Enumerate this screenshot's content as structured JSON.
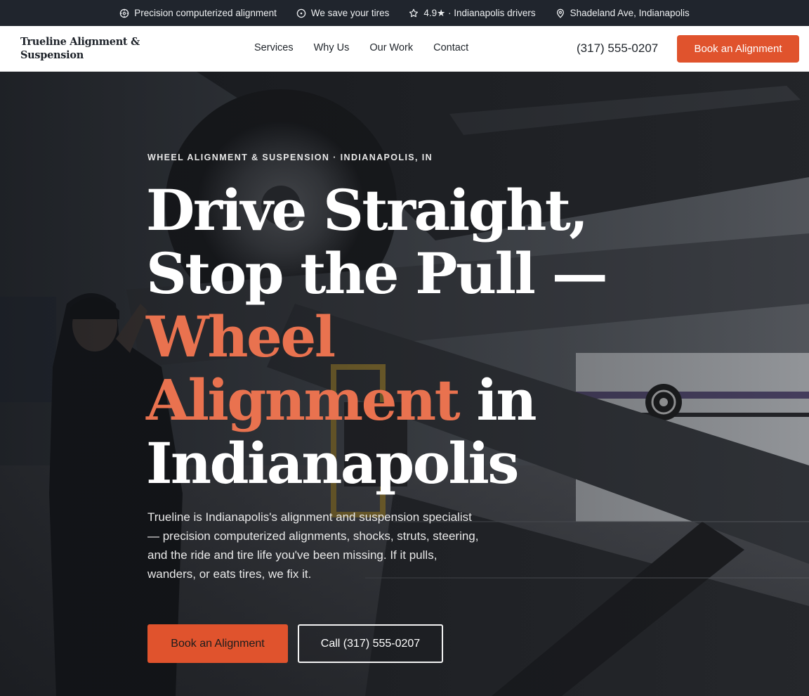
{
  "topbar": {
    "items": [
      {
        "icon": "crosshair-icon",
        "text": "Precision computerized alignment"
      },
      {
        "icon": "tire-icon",
        "text": "We save your tires"
      },
      {
        "icon": "star-icon",
        "text": "4.9★ · Indianapolis drivers"
      },
      {
        "icon": "map-pin-icon",
        "text": "Shadeland Ave, Indianapolis"
      }
    ]
  },
  "header": {
    "logo_line1": "Trueline Alignment &",
    "logo_line2": "Suspension",
    "nav": [
      "Services",
      "Why Us",
      "Our Work",
      "Contact"
    ],
    "phone": "(317) 555-0207",
    "cta": "Book an Alignment"
  },
  "hero": {
    "eyebrow": "WHEEL ALIGNMENT & SUSPENSION · INDIANAPOLIS, IN",
    "headline_part1": "Drive Straight, Stop the Pull — ",
    "headline_accent": "Wheel Alignment",
    "headline_part2": " in Indianapolis",
    "lede": "Trueline is Indianapolis's alignment and suspension specialist — precision computerized alignments, shocks, struts, steering, and the ride and tire life you've been missing. If it pulls, wanders, or eats tires, we fix it.",
    "primary_cta": "Book an Alignment",
    "secondary_cta": "Call (317) 555-0207"
  },
  "colors": {
    "accent": "#e0532d",
    "accent_text": "#e9724f",
    "topbar_bg": "#20252d"
  }
}
